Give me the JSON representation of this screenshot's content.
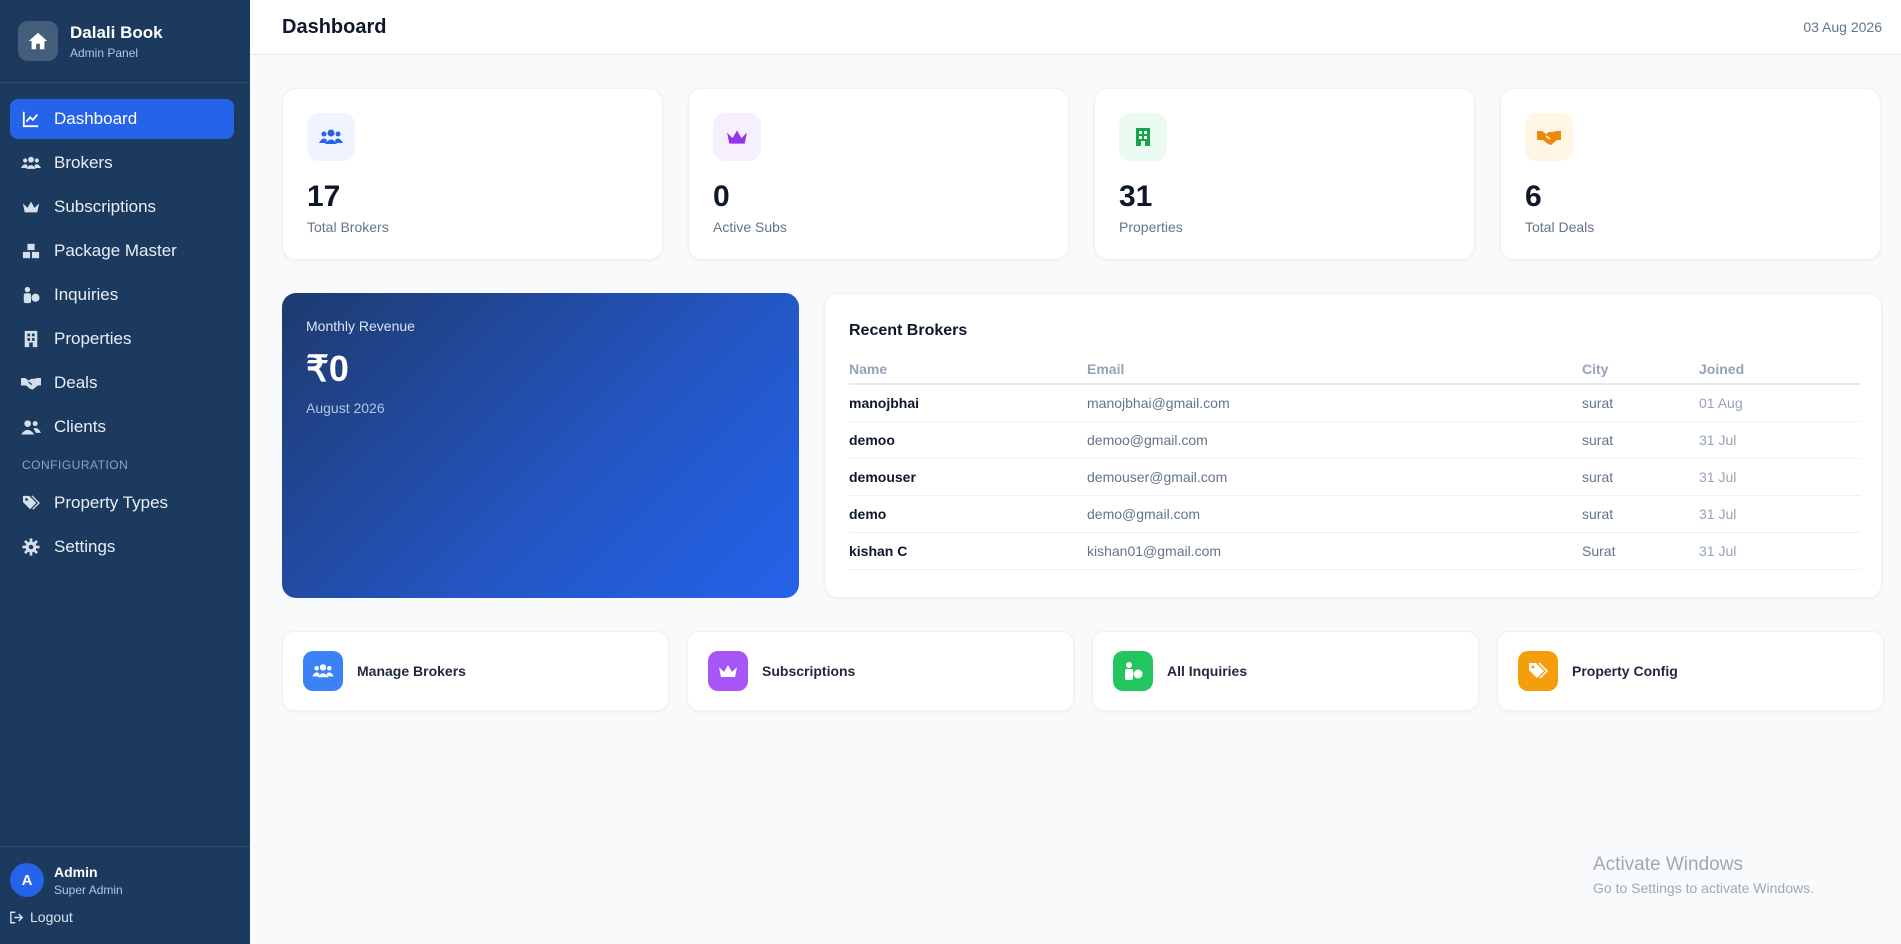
{
  "brand": {
    "title": "Dalali Book",
    "subtitle": "Admin Panel",
    "icon": "home-icon"
  },
  "nav": {
    "items": [
      {
        "label": "Dashboard",
        "icon": "chart-line-icon",
        "active": true
      },
      {
        "label": "Brokers",
        "icon": "users-icon"
      },
      {
        "label": "Subscriptions",
        "icon": "crown-icon"
      },
      {
        "label": "Package Master",
        "icon": "boxes-icon"
      },
      {
        "label": "Inquiries",
        "icon": "person-question-icon"
      },
      {
        "label": "Properties",
        "icon": "building-icon"
      },
      {
        "label": "Deals",
        "icon": "handshake-icon"
      },
      {
        "label": "Clients",
        "icon": "user-group-icon"
      }
    ],
    "section_label": "CONFIGURATION",
    "config_items": [
      {
        "label": "Property Types",
        "icon": "tags-icon"
      },
      {
        "label": "Settings",
        "icon": "gear-icon"
      }
    ]
  },
  "user": {
    "initial": "A",
    "name": "Admin",
    "role": "Super Admin",
    "logout_label": "Logout"
  },
  "header": {
    "title": "Dashboard",
    "date": "03 Aug 2026"
  },
  "stats": [
    {
      "value": "17",
      "label": "Total Brokers",
      "icon": "users-icon",
      "color": "#2563eb",
      "bg": "#eff4ff"
    },
    {
      "value": "0",
      "label": "Active Subs",
      "icon": "crown-icon",
      "color": "#9333ea",
      "bg": "#f6effe"
    },
    {
      "value": "31",
      "label": "Properties",
      "icon": "building-icon",
      "color": "#16a34a",
      "bg": "#ecfbf1"
    },
    {
      "value": "6",
      "label": "Total Deals",
      "icon": "handshake-icon",
      "color": "#ea8a0c",
      "bg": "#fff6e6"
    }
  ],
  "revenue": {
    "label": "Monthly Revenue",
    "amount": "₹0",
    "period": "August 2026"
  },
  "recent_brokers": {
    "title": "Recent Brokers",
    "columns": [
      "Name",
      "Email",
      "City",
      "Joined"
    ],
    "rows": [
      {
        "name": "manojbhai",
        "email": "manojbhai@gmail.com",
        "city": "surat",
        "joined": "01 Aug"
      },
      {
        "name": "demoo",
        "email": "demoo@gmail.com",
        "city": "surat",
        "joined": "31 Jul"
      },
      {
        "name": "demouser",
        "email": "demouser@gmail.com",
        "city": "surat",
        "joined": "31 Jul"
      },
      {
        "name": "demo",
        "email": "demo@gmail.com",
        "city": "surat",
        "joined": "31 Jul"
      },
      {
        "name": "kishan C",
        "email": "kishan01@gmail.com",
        "city": "Surat",
        "joined": "31 Jul"
      }
    ]
  },
  "quick_links": [
    {
      "label": "Manage Brokers",
      "icon": "users-icon",
      "color": "#3b82f6"
    },
    {
      "label": "Subscriptions",
      "icon": "crown-icon",
      "color": "#a855f7"
    },
    {
      "label": "All Inquiries",
      "icon": "person-question-icon",
      "color": "#22c55e"
    },
    {
      "label": "Property Config",
      "icon": "tags-icon",
      "color": "#f59e0b"
    }
  ],
  "watermark": {
    "title": "Activate Windows",
    "subtitle": "Go to Settings to activate Windows."
  }
}
